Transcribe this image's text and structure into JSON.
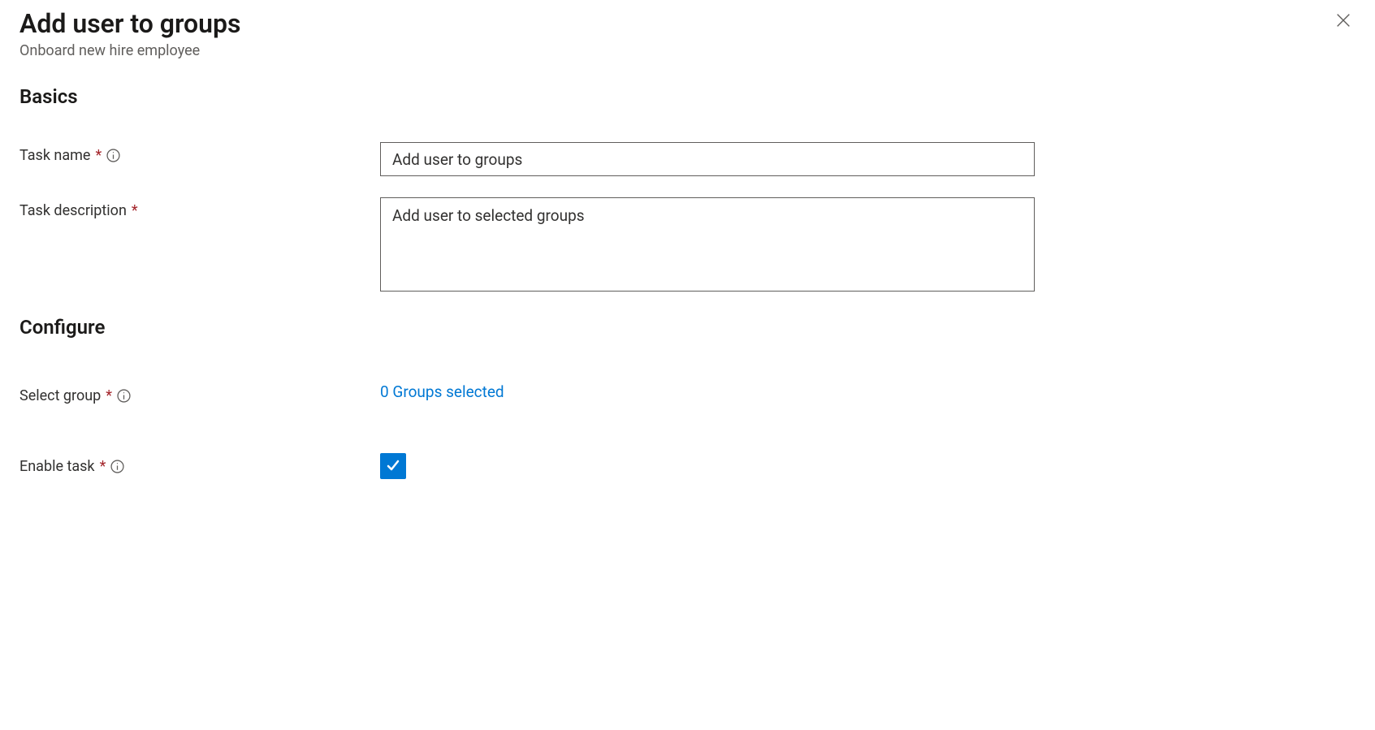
{
  "header": {
    "title": "Add user to groups",
    "subtitle": "Onboard new hire employee"
  },
  "sections": {
    "basics": {
      "title": "Basics",
      "task_name": {
        "label": "Task name",
        "value": "Add user to groups"
      },
      "task_description": {
        "label": "Task description",
        "value": "Add user to selected groups"
      }
    },
    "configure": {
      "title": "Configure",
      "select_group": {
        "label": "Select group",
        "link_text": "0 Groups selected"
      },
      "enable_task": {
        "label": "Enable task",
        "checked": true
      }
    }
  }
}
